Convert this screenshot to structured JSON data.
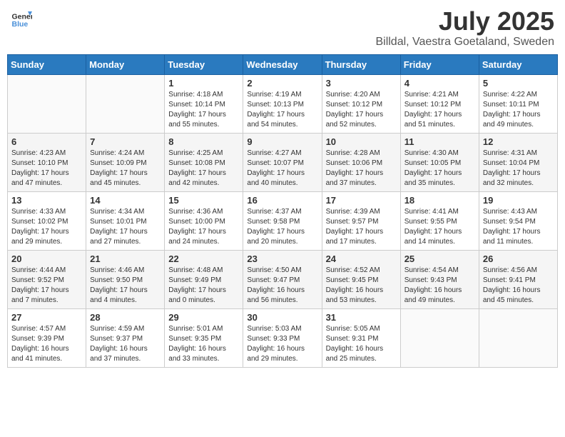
{
  "header": {
    "logo_general": "General",
    "logo_blue": "Blue",
    "month": "July 2025",
    "location": "Billdal, Vaestra Goetaland, Sweden"
  },
  "days_of_week": [
    "Sunday",
    "Monday",
    "Tuesday",
    "Wednesday",
    "Thursday",
    "Friday",
    "Saturday"
  ],
  "weeks": [
    [
      {
        "day": "",
        "sunrise": "",
        "sunset": "",
        "daylight": ""
      },
      {
        "day": "",
        "sunrise": "",
        "sunset": "",
        "daylight": ""
      },
      {
        "day": "1",
        "sunrise": "Sunrise: 4:18 AM",
        "sunset": "Sunset: 10:14 PM",
        "daylight": "Daylight: 17 hours and 55 minutes."
      },
      {
        "day": "2",
        "sunrise": "Sunrise: 4:19 AM",
        "sunset": "Sunset: 10:13 PM",
        "daylight": "Daylight: 17 hours and 54 minutes."
      },
      {
        "day": "3",
        "sunrise": "Sunrise: 4:20 AM",
        "sunset": "Sunset: 10:12 PM",
        "daylight": "Daylight: 17 hours and 52 minutes."
      },
      {
        "day": "4",
        "sunrise": "Sunrise: 4:21 AM",
        "sunset": "Sunset: 10:12 PM",
        "daylight": "Daylight: 17 hours and 51 minutes."
      },
      {
        "day": "5",
        "sunrise": "Sunrise: 4:22 AM",
        "sunset": "Sunset: 10:11 PM",
        "daylight": "Daylight: 17 hours and 49 minutes."
      }
    ],
    [
      {
        "day": "6",
        "sunrise": "Sunrise: 4:23 AM",
        "sunset": "Sunset: 10:10 PM",
        "daylight": "Daylight: 17 hours and 47 minutes."
      },
      {
        "day": "7",
        "sunrise": "Sunrise: 4:24 AM",
        "sunset": "Sunset: 10:09 PM",
        "daylight": "Daylight: 17 hours and 45 minutes."
      },
      {
        "day": "8",
        "sunrise": "Sunrise: 4:25 AM",
        "sunset": "Sunset: 10:08 PM",
        "daylight": "Daylight: 17 hours and 42 minutes."
      },
      {
        "day": "9",
        "sunrise": "Sunrise: 4:27 AM",
        "sunset": "Sunset: 10:07 PM",
        "daylight": "Daylight: 17 hours and 40 minutes."
      },
      {
        "day": "10",
        "sunrise": "Sunrise: 4:28 AM",
        "sunset": "Sunset: 10:06 PM",
        "daylight": "Daylight: 17 hours and 37 minutes."
      },
      {
        "day": "11",
        "sunrise": "Sunrise: 4:30 AM",
        "sunset": "Sunset: 10:05 PM",
        "daylight": "Daylight: 17 hours and 35 minutes."
      },
      {
        "day": "12",
        "sunrise": "Sunrise: 4:31 AM",
        "sunset": "Sunset: 10:04 PM",
        "daylight": "Daylight: 17 hours and 32 minutes."
      }
    ],
    [
      {
        "day": "13",
        "sunrise": "Sunrise: 4:33 AM",
        "sunset": "Sunset: 10:02 PM",
        "daylight": "Daylight: 17 hours and 29 minutes."
      },
      {
        "day": "14",
        "sunrise": "Sunrise: 4:34 AM",
        "sunset": "Sunset: 10:01 PM",
        "daylight": "Daylight: 17 hours and 27 minutes."
      },
      {
        "day": "15",
        "sunrise": "Sunrise: 4:36 AM",
        "sunset": "Sunset: 10:00 PM",
        "daylight": "Daylight: 17 hours and 24 minutes."
      },
      {
        "day": "16",
        "sunrise": "Sunrise: 4:37 AM",
        "sunset": "Sunset: 9:58 PM",
        "daylight": "Daylight: 17 hours and 20 minutes."
      },
      {
        "day": "17",
        "sunrise": "Sunrise: 4:39 AM",
        "sunset": "Sunset: 9:57 PM",
        "daylight": "Daylight: 17 hours and 17 minutes."
      },
      {
        "day": "18",
        "sunrise": "Sunrise: 4:41 AM",
        "sunset": "Sunset: 9:55 PM",
        "daylight": "Daylight: 17 hours and 14 minutes."
      },
      {
        "day": "19",
        "sunrise": "Sunrise: 4:43 AM",
        "sunset": "Sunset: 9:54 PM",
        "daylight": "Daylight: 17 hours and 11 minutes."
      }
    ],
    [
      {
        "day": "20",
        "sunrise": "Sunrise: 4:44 AM",
        "sunset": "Sunset: 9:52 PM",
        "daylight": "Daylight: 17 hours and 7 minutes."
      },
      {
        "day": "21",
        "sunrise": "Sunrise: 4:46 AM",
        "sunset": "Sunset: 9:50 PM",
        "daylight": "Daylight: 17 hours and 4 minutes."
      },
      {
        "day": "22",
        "sunrise": "Sunrise: 4:48 AM",
        "sunset": "Sunset: 9:49 PM",
        "daylight": "Daylight: 17 hours and 0 minutes."
      },
      {
        "day": "23",
        "sunrise": "Sunrise: 4:50 AM",
        "sunset": "Sunset: 9:47 PM",
        "daylight": "Daylight: 16 hours and 56 minutes."
      },
      {
        "day": "24",
        "sunrise": "Sunrise: 4:52 AM",
        "sunset": "Sunset: 9:45 PM",
        "daylight": "Daylight: 16 hours and 53 minutes."
      },
      {
        "day": "25",
        "sunrise": "Sunrise: 4:54 AM",
        "sunset": "Sunset: 9:43 PM",
        "daylight": "Daylight: 16 hours and 49 minutes."
      },
      {
        "day": "26",
        "sunrise": "Sunrise: 4:56 AM",
        "sunset": "Sunset: 9:41 PM",
        "daylight": "Daylight: 16 hours and 45 minutes."
      }
    ],
    [
      {
        "day": "27",
        "sunrise": "Sunrise: 4:57 AM",
        "sunset": "Sunset: 9:39 PM",
        "daylight": "Daylight: 16 hours and 41 minutes."
      },
      {
        "day": "28",
        "sunrise": "Sunrise: 4:59 AM",
        "sunset": "Sunset: 9:37 PM",
        "daylight": "Daylight: 16 hours and 37 minutes."
      },
      {
        "day": "29",
        "sunrise": "Sunrise: 5:01 AM",
        "sunset": "Sunset: 9:35 PM",
        "daylight": "Daylight: 16 hours and 33 minutes."
      },
      {
        "day": "30",
        "sunrise": "Sunrise: 5:03 AM",
        "sunset": "Sunset: 9:33 PM",
        "daylight": "Daylight: 16 hours and 29 minutes."
      },
      {
        "day": "31",
        "sunrise": "Sunrise: 5:05 AM",
        "sunset": "Sunset: 9:31 PM",
        "daylight": "Daylight: 16 hours and 25 minutes."
      },
      {
        "day": "",
        "sunrise": "",
        "sunset": "",
        "daylight": ""
      },
      {
        "day": "",
        "sunrise": "",
        "sunset": "",
        "daylight": ""
      }
    ]
  ]
}
